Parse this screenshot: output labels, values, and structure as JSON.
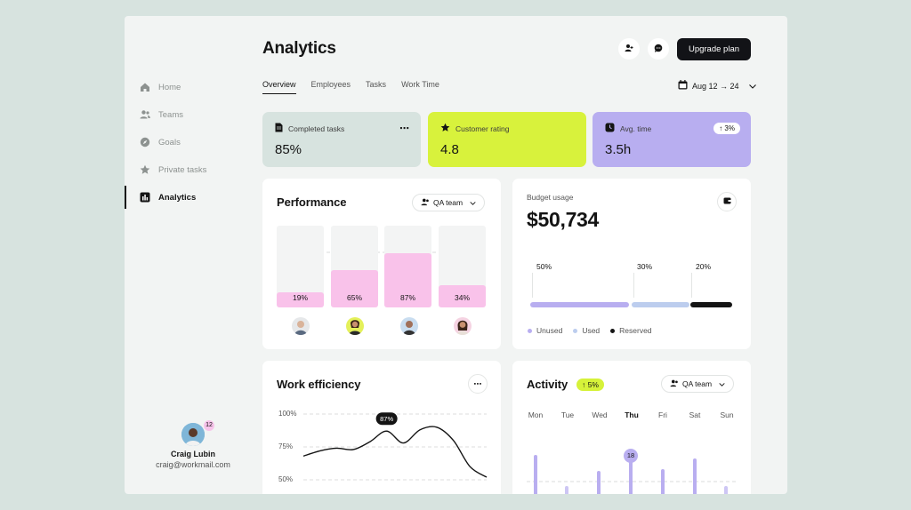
{
  "title": "Analytics",
  "header": {
    "upgrade_label": "Upgrade plan",
    "date_range": "Aug 12 → 24"
  },
  "tabs": [
    "Overview",
    "Employees",
    "Tasks",
    "Work Time"
  ],
  "sidebar": {
    "items": [
      {
        "label": "Home",
        "icon": "home-icon"
      },
      {
        "label": "Teams",
        "icon": "users-icon"
      },
      {
        "label": "Goals",
        "icon": "compass-icon"
      },
      {
        "label": "Private tasks",
        "icon": "star-icon"
      },
      {
        "label": "Analytics",
        "icon": "chart-icon",
        "active": true
      }
    ],
    "user": {
      "name": "Craig Lubin",
      "email": "craig@workmail.com",
      "badge": "12"
    }
  },
  "stats": [
    {
      "label": "Completed tasks",
      "value": "85%",
      "color": "#d7e3df"
    },
    {
      "label": "Customer rating",
      "value": "4.8",
      "color": "#d8f23c"
    },
    {
      "label": "Avg. time",
      "value": "3.5h",
      "change": "↑ 3%",
      "color": "#b8aef0"
    }
  ],
  "performance": {
    "title": "Performance",
    "filter": "QA team",
    "bars": [
      {
        "label": "19%",
        "value": 0.19
      },
      {
        "label": "65%",
        "value": 0.46
      },
      {
        "label": "87%",
        "value": 0.66
      },
      {
        "label": "34%",
        "value": 0.27
      }
    ]
  },
  "budget": {
    "label": "Budget usage",
    "value": "$50,734",
    "segments": [
      {
        "label": "50%",
        "name": "Unused",
        "color": "#b8aef0"
      },
      {
        "label": "30%",
        "name": "Used",
        "color": "#bccdee"
      },
      {
        "label": "20%",
        "name": "Reserved",
        "color": "#141414"
      }
    ]
  },
  "efficiency": {
    "title": "Work efficiency",
    "y_labels": [
      "100%",
      "75%",
      "50%"
    ],
    "peak_label": "87%"
  },
  "activity": {
    "title": "Activity",
    "change": "↑ 5%",
    "filter": "QA team",
    "days": [
      "Mon",
      "Tue",
      "Wed",
      "Thu",
      "Fri",
      "Sat",
      "Sun"
    ],
    "active_day": "Thu",
    "pin_value": "18"
  },
  "chart_data": {
    "type": "line",
    "title": "Work efficiency",
    "xlabel": "",
    "ylabel": "",
    "ylim": [
      50,
      100
    ],
    "y_ticks": [
      "100%",
      "75%",
      "50%"
    ],
    "series": [
      {
        "values": [
          68,
          72,
          74,
          73,
          79,
          87,
          78,
          88,
          90,
          80,
          60,
          52
        ]
      }
    ],
    "annotations": [
      {
        "text": "87%",
        "index": 5
      }
    ],
    "grid": true
  }
}
